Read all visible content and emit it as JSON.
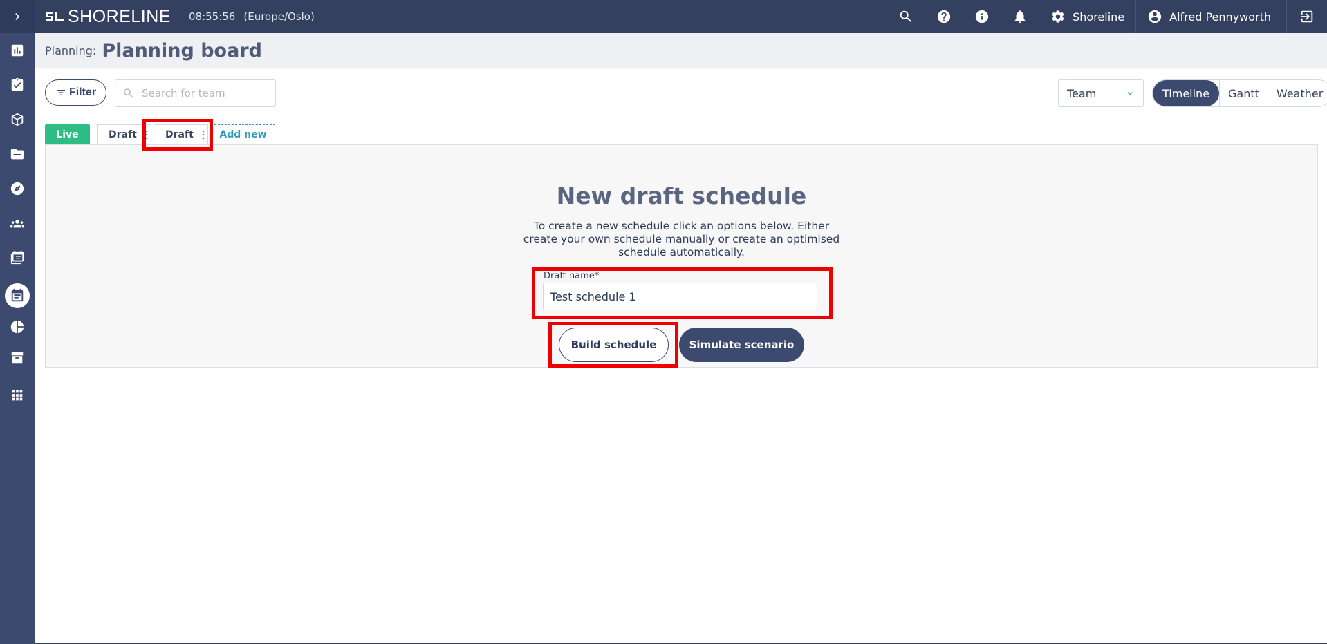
{
  "app": {
    "brand": "SHORELINE",
    "clock": "08:55:56",
    "timezone": "(Europe/Oslo)"
  },
  "topbar": {
    "org_label": "Shoreline",
    "user_label": "Alfred Pennyworth"
  },
  "header": {
    "breadcrumb": "Planning:",
    "title": "Planning board"
  },
  "toolbar": {
    "filter_label": "Filter",
    "search_placeholder": "Search for team",
    "group_by": "Team",
    "views": [
      "Timeline",
      "Gantt",
      "Weather"
    ],
    "active_view": "Timeline"
  },
  "tabs": {
    "live": "Live",
    "drafts": [
      "Draft",
      "Draft"
    ],
    "add_new": "Add new"
  },
  "panel": {
    "title": "New draft schedule",
    "description": "To create a new schedule click an options below. Either create your own schedule manually or create an optimised schedule automatically.",
    "field_label": "Draft name*",
    "field_value": "Test schedule 1",
    "build_button": "Build schedule",
    "simulate_button": "Simulate scenario"
  },
  "colors": {
    "sidebar": "#3b4a6e",
    "topbar": "#34405f",
    "live_tab": "#2ebd85",
    "accent": "#2a9bb8",
    "highlight": "#ee0000"
  }
}
